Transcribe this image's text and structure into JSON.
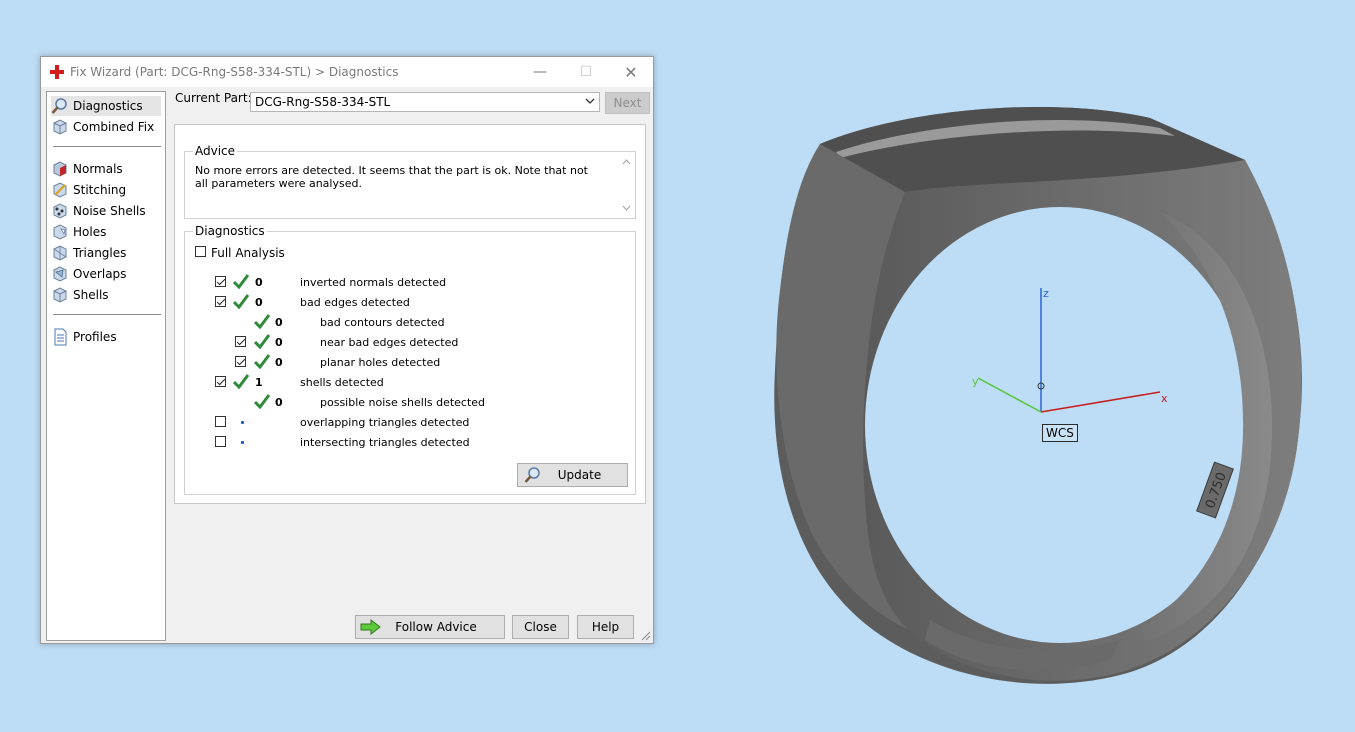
{
  "window": {
    "title": "Fix Wizard (Part: DCG-Rng-S58-334-STL) > Diagnostics",
    "controls": {
      "minimize": "—",
      "maximize": "☐",
      "close": "✕"
    }
  },
  "sidebar": {
    "items": [
      {
        "label": "Diagnostics",
        "icon": "magnifier-icon",
        "selected": true
      },
      {
        "label": "Combined Fix",
        "icon": "cube-icon"
      },
      {
        "label": "Normals",
        "icon": "normals-cube-icon"
      },
      {
        "label": "Stitching",
        "icon": "stitching-icon"
      },
      {
        "label": "Noise Shells",
        "icon": "noise-shells-icon"
      },
      {
        "label": "Holes",
        "icon": "holes-icon"
      },
      {
        "label": "Triangles",
        "icon": "triangles-icon"
      },
      {
        "label": "Overlaps",
        "icon": "overlaps-icon"
      },
      {
        "label": "Shells",
        "icon": "shells-icon"
      },
      {
        "label": "Profiles",
        "icon": "document-icon"
      }
    ]
  },
  "current_part": {
    "label": "Current Part:",
    "value": "DCG-Rng-S58-334-STL",
    "next_label": "Next"
  },
  "advice": {
    "title": "Advice",
    "text": "No more errors are detected. It seems that the part is ok. Note that not all parameters were analysed."
  },
  "diagnostics": {
    "title": "Diagnostics",
    "full_analysis_label": "Full Analysis",
    "rows": [
      {
        "checked": true,
        "status": "ok",
        "count": "0",
        "label": "inverted normals detected"
      },
      {
        "checked": true,
        "status": "ok",
        "count": "0",
        "label": "bad edges detected"
      },
      {
        "checkbox": false,
        "status": "ok",
        "count": "0",
        "label": "bad contours detected"
      },
      {
        "checked": true,
        "status": "ok",
        "count": "0",
        "label": "near bad edges detected"
      },
      {
        "checked": true,
        "status": "ok",
        "count": "0",
        "label": "planar holes detected"
      },
      {
        "checked": true,
        "status": "ok",
        "count": "1",
        "label": "shells detected"
      },
      {
        "checkbox": false,
        "status": "ok",
        "count": "0",
        "label": "possible noise shells detected"
      },
      {
        "checked": false,
        "status": "pending",
        "count": "",
        "label": "overlapping triangles detected"
      },
      {
        "checked": false,
        "status": "pending",
        "count": "",
        "label": "intersecting triangles detected"
      }
    ],
    "update_label": "Update"
  },
  "footer": {
    "follow_advice_label": "Follow Advice",
    "close_label": "Close",
    "help_label": "Help"
  },
  "viewport": {
    "wcs_label": "WCS",
    "axis_x": "x",
    "axis_y": "y",
    "axis_z": "z",
    "ring_engraving": "0.750"
  },
  "colors": {
    "background": "#bddcf5",
    "check_green": "#2e8b3a",
    "axis_x": "#c81e1e",
    "axis_y": "#55c53a",
    "axis_z": "#2a66d6"
  }
}
